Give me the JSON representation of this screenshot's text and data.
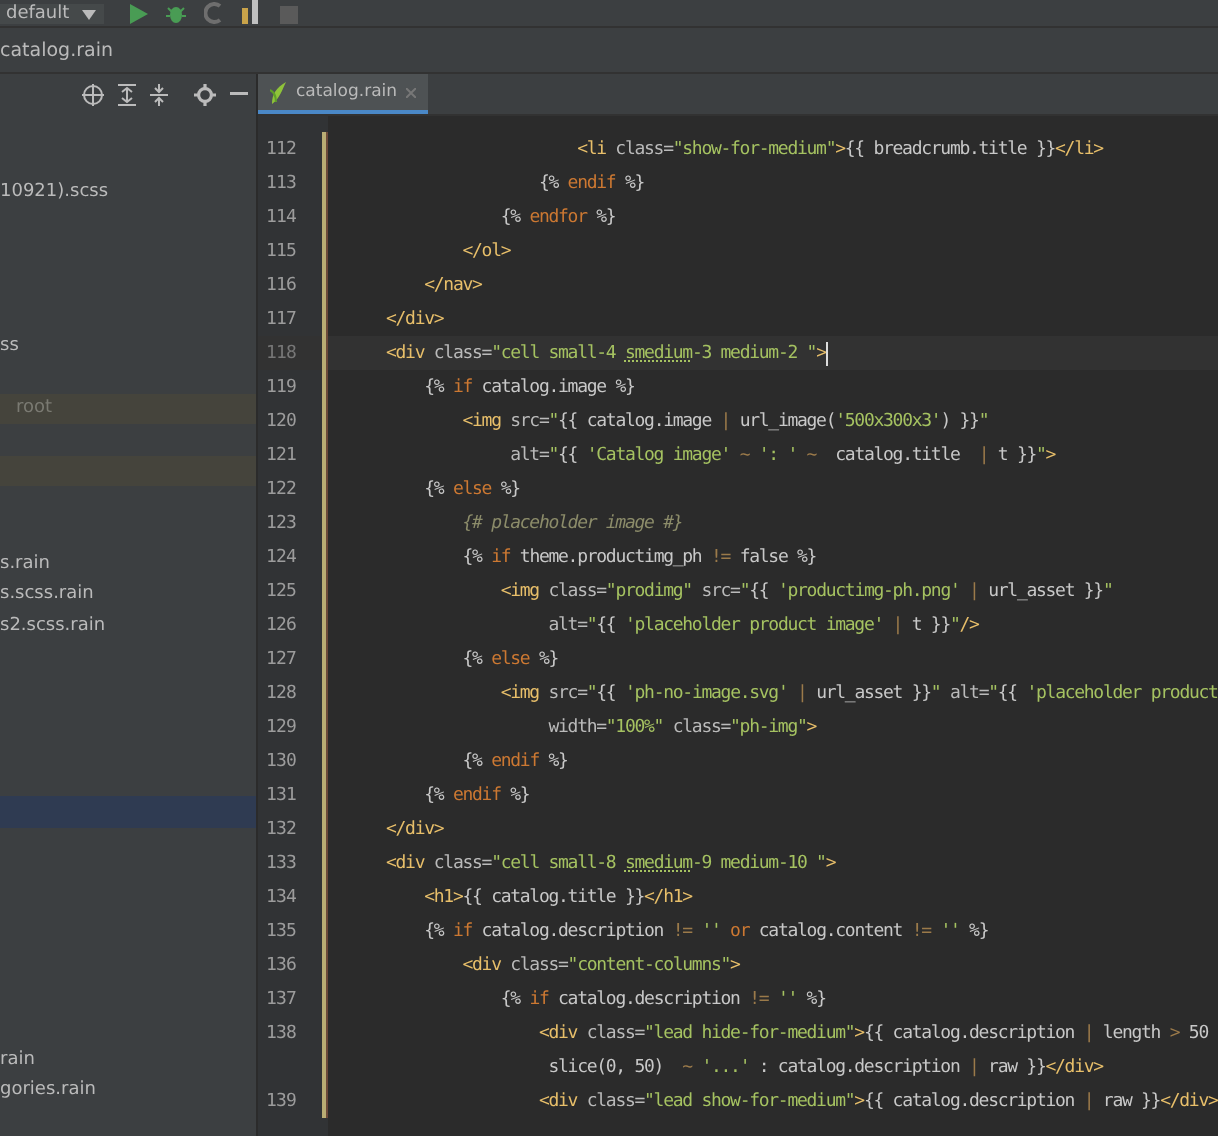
{
  "toolbar": {
    "run_configuration": "default"
  },
  "breadcrumb": [
    "catalog.rain"
  ],
  "project_tree": {
    "rows": [
      {
        "label": "10921).scss",
        "selected": false,
        "highlighted": false
      },
      {
        "label": "ss",
        "selected": false,
        "highlighted": false
      },
      {
        "label": "root",
        "selected": false,
        "highlighted": true
      },
      {
        "kind": "scope-band"
      },
      {
        "label": "s.rain",
        "selected": false,
        "highlighted": false
      },
      {
        "label": "s.scss.rain",
        "selected": false,
        "highlighted": false
      },
      {
        "label": "s2.scss.rain",
        "selected": false,
        "highlighted": false
      },
      {
        "selected": true,
        "highlighted": false
      },
      {
        "label": "rain",
        "selected": false,
        "highlighted": false
      },
      {
        "label": "gories.rain",
        "selected": false,
        "highlighted": false
      }
    ]
  },
  "editor": {
    "tabs": [
      {
        "label": "catalog.rain",
        "selected": true
      }
    ],
    "lines": [
      {
        "number": "112",
        "current": false,
        "tokens": [
          {
            "kind": "tag",
            "text": "                    <li"
          },
          {
            "kind": "attr",
            "text": " class="
          },
          {
            "kind": "str",
            "text": "\"show-for-medium\""
          },
          {
            "kind": "tag",
            "text": ">"
          },
          {
            "kind": "plain",
            "text": "{{ breadcrumb.title }}"
          },
          {
            "kind": "tag",
            "text": "</li>"
          }
        ]
      },
      {
        "number": "113",
        "current": false,
        "tokens": [
          {
            "kind": "plain",
            "text": "                {% "
          },
          {
            "kind": "kw",
            "text": "endif"
          },
          {
            "kind": "plain",
            "text": " %}"
          }
        ]
      },
      {
        "number": "114",
        "current": false,
        "tokens": [
          {
            "kind": "plain",
            "text": "            {% "
          },
          {
            "kind": "kw",
            "text": "endfor"
          },
          {
            "kind": "plain",
            "text": " %}"
          }
        ]
      },
      {
        "number": "115",
        "current": false,
        "tokens": [
          {
            "kind": "tag",
            "text": "        </ol>"
          }
        ]
      },
      {
        "number": "116",
        "current": false,
        "tokens": [
          {
            "kind": "tag",
            "text": "    </nav>"
          }
        ]
      },
      {
        "number": "117",
        "current": false,
        "tokens": [
          {
            "kind": "tag",
            "text": "</div>"
          }
        ]
      },
      {
        "number": "118",
        "current": true,
        "tokens": [
          {
            "kind": "tag",
            "text": "<div"
          },
          {
            "kind": "attr",
            "text": " class="
          },
          {
            "kind": "str",
            "text": "\"cell small-4 "
          },
          {
            "kind": "typo",
            "text": "smedium"
          },
          {
            "kind": "str",
            "text": "-3 medium-2 \""
          },
          {
            "kind": "tag",
            "text": ">"
          }
        ]
      },
      {
        "number": "119",
        "current": false,
        "tokens": [
          {
            "kind": "plain",
            "text": "    {% "
          },
          {
            "kind": "kw",
            "text": "if"
          },
          {
            "kind": "plain",
            "text": " catalog.image %}"
          }
        ]
      },
      {
        "number": "120",
        "current": false,
        "tokens": [
          {
            "kind": "tag",
            "text": "        <img"
          },
          {
            "kind": "attr",
            "text": " src="
          },
          {
            "kind": "str",
            "text": "\""
          },
          {
            "kind": "plain",
            "text": "{{ catalog.image "
          },
          {
            "kind": "op",
            "text": "|"
          },
          {
            "kind": "plain",
            "text": " url_image("
          },
          {
            "kind": "str",
            "text": "'500x300x3'"
          },
          {
            "kind": "plain",
            "text": ") }}"
          },
          {
            "kind": "str",
            "text": "\""
          }
        ]
      },
      {
        "number": "121",
        "current": false,
        "tokens": [
          {
            "kind": "attr",
            "text": "             alt="
          },
          {
            "kind": "str",
            "text": "\""
          },
          {
            "kind": "plain",
            "text": "{{ "
          },
          {
            "kind": "str",
            "text": "'Catalog image'"
          },
          {
            "kind": "op",
            "text": " ~ "
          },
          {
            "kind": "str",
            "text": "': '"
          },
          {
            "kind": "op",
            "text": " ~ "
          },
          {
            "kind": "plain",
            "text": " catalog.title  "
          },
          {
            "kind": "op",
            "text": "|"
          },
          {
            "kind": "plain",
            "text": " t }}"
          },
          {
            "kind": "str",
            "text": "\""
          },
          {
            "kind": "tag",
            "text": ">"
          }
        ]
      },
      {
        "number": "122",
        "current": false,
        "tokens": [
          {
            "kind": "plain",
            "text": "    {% "
          },
          {
            "kind": "kw",
            "text": "else"
          },
          {
            "kind": "plain",
            "text": " %}"
          }
        ]
      },
      {
        "number": "123",
        "current": false,
        "tokens": [
          {
            "kind": "comment",
            "text": "        {# placeholder image #}"
          }
        ]
      },
      {
        "number": "124",
        "current": false,
        "tokens": [
          {
            "kind": "plain",
            "text": "        {% "
          },
          {
            "kind": "kw",
            "text": "if"
          },
          {
            "kind": "plain",
            "text": " theme.productimg_ph "
          },
          {
            "kind": "op",
            "text": "!="
          },
          {
            "kind": "plain",
            "text": " false %}"
          }
        ]
      },
      {
        "number": "125",
        "current": false,
        "tokens": [
          {
            "kind": "tag",
            "text": "            <img"
          },
          {
            "kind": "attr",
            "text": " class="
          },
          {
            "kind": "str",
            "text": "\"prodimg\""
          },
          {
            "kind": "attr",
            "text": " src="
          },
          {
            "kind": "str",
            "text": "\""
          },
          {
            "kind": "plain",
            "text": "{{ "
          },
          {
            "kind": "str",
            "text": "'productimg-ph.png'"
          },
          {
            "kind": "op",
            "text": " | "
          },
          {
            "kind": "plain",
            "text": "url_asset }}"
          },
          {
            "kind": "str",
            "text": "\""
          }
        ]
      },
      {
        "number": "126",
        "current": false,
        "tokens": [
          {
            "kind": "attr",
            "text": "                 alt="
          },
          {
            "kind": "str",
            "text": "\""
          },
          {
            "kind": "plain",
            "text": "{{ "
          },
          {
            "kind": "str",
            "text": "'placeholder product image'"
          },
          {
            "kind": "op",
            "text": " | "
          },
          {
            "kind": "plain",
            "text": "t }}"
          },
          {
            "kind": "str",
            "text": "\""
          },
          {
            "kind": "tag",
            "text": "/>"
          }
        ]
      },
      {
        "number": "127",
        "current": false,
        "tokens": [
          {
            "kind": "plain",
            "text": "        {% "
          },
          {
            "kind": "kw",
            "text": "else"
          },
          {
            "kind": "plain",
            "text": " %}"
          }
        ]
      },
      {
        "number": "128",
        "current": false,
        "tokens": [
          {
            "kind": "tag",
            "text": "            <img"
          },
          {
            "kind": "attr",
            "text": " src="
          },
          {
            "kind": "str",
            "text": "\""
          },
          {
            "kind": "plain",
            "text": "{{ "
          },
          {
            "kind": "str",
            "text": "'ph-no-image.svg'"
          },
          {
            "kind": "op",
            "text": " | "
          },
          {
            "kind": "plain",
            "text": "url_asset }}"
          },
          {
            "kind": "str",
            "text": "\""
          },
          {
            "kind": "attr",
            "text": " alt="
          },
          {
            "kind": "str",
            "text": "\""
          },
          {
            "kind": "plain",
            "text": "{{ "
          },
          {
            "kind": "str",
            "text": "'placeholder product"
          }
        ]
      },
      {
        "number": "129",
        "current": false,
        "tokens": [
          {
            "kind": "attr",
            "text": "                 width="
          },
          {
            "kind": "str",
            "text": "\"100%\""
          },
          {
            "kind": "attr",
            "text": " class="
          },
          {
            "kind": "str",
            "text": "\"ph-img\""
          },
          {
            "kind": "tag",
            "text": ">"
          }
        ]
      },
      {
        "number": "130",
        "current": false,
        "tokens": [
          {
            "kind": "plain",
            "text": "        {% "
          },
          {
            "kind": "kw",
            "text": "endif"
          },
          {
            "kind": "plain",
            "text": " %}"
          }
        ]
      },
      {
        "number": "131",
        "current": false,
        "tokens": [
          {
            "kind": "plain",
            "text": "    {% "
          },
          {
            "kind": "kw",
            "text": "endif"
          },
          {
            "kind": "plain",
            "text": " %}"
          }
        ]
      },
      {
        "number": "132",
        "current": false,
        "tokens": [
          {
            "kind": "tag",
            "text": "</div>"
          }
        ]
      },
      {
        "number": "133",
        "current": false,
        "tokens": [
          {
            "kind": "tag",
            "text": "<div"
          },
          {
            "kind": "attr",
            "text": " class="
          },
          {
            "kind": "str",
            "text": "\"cell small-8 "
          },
          {
            "kind": "typo",
            "text": "smedium"
          },
          {
            "kind": "str",
            "text": "-9 medium-10 \""
          },
          {
            "kind": "tag",
            "text": ">"
          }
        ]
      },
      {
        "number": "134",
        "current": false,
        "tokens": [
          {
            "kind": "tag",
            "text": "    <h1>"
          },
          {
            "kind": "plain",
            "text": "{{ catalog.title }}"
          },
          {
            "kind": "tag",
            "text": "</h1>"
          }
        ]
      },
      {
        "number": "135",
        "current": false,
        "tokens": [
          {
            "kind": "plain",
            "text": "    {% "
          },
          {
            "kind": "kw",
            "text": "if"
          },
          {
            "kind": "plain",
            "text": " catalog.description "
          },
          {
            "kind": "op",
            "text": "!="
          },
          {
            "kind": "str",
            "text": " ''"
          },
          {
            "kind": "kw",
            "text": " or"
          },
          {
            "kind": "plain",
            "text": " catalog.content "
          },
          {
            "kind": "op",
            "text": "!="
          },
          {
            "kind": "str",
            "text": " ''"
          },
          {
            "kind": "plain",
            "text": " %}"
          }
        ]
      },
      {
        "number": "136",
        "current": false,
        "tokens": [
          {
            "kind": "tag",
            "text": "        <div"
          },
          {
            "kind": "attr",
            "text": " class="
          },
          {
            "kind": "str",
            "text": "\"content-columns\""
          },
          {
            "kind": "tag",
            "text": ">"
          }
        ]
      },
      {
        "number": "137",
        "current": false,
        "tokens": [
          {
            "kind": "plain",
            "text": "            {% "
          },
          {
            "kind": "kw",
            "text": "if"
          },
          {
            "kind": "plain",
            "text": " catalog.description "
          },
          {
            "kind": "op",
            "text": "!="
          },
          {
            "kind": "str",
            "text": " ''"
          },
          {
            "kind": "plain",
            "text": " %}"
          }
        ]
      },
      {
        "number": "138",
        "current": false,
        "tokens": [
          {
            "kind": "tag",
            "text": "                <div"
          },
          {
            "kind": "attr",
            "text": " class="
          },
          {
            "kind": "str",
            "text": "\"lead hide-for-medium\""
          },
          {
            "kind": "tag",
            "text": ">"
          },
          {
            "kind": "plain",
            "text": "{{ catalog.description "
          },
          {
            "kind": "op",
            "text": "|"
          },
          {
            "kind": "plain",
            "text": " length "
          },
          {
            "kind": "op",
            "text": ">"
          },
          {
            "kind": "plain",
            "text": " 50"
          }
        ],
        "continuation": [
          {
            "kind": "plain",
            "text": "                 slice(0, 50)  "
          },
          {
            "kind": "op",
            "text": "~"
          },
          {
            "kind": "str",
            "text": " '...'"
          },
          {
            "kind": "plain",
            "text": " : catalog.description "
          },
          {
            "kind": "op",
            "text": "|"
          },
          {
            "kind": "plain",
            "text": " raw }}"
          },
          {
            "kind": "tag",
            "text": "</div>"
          }
        ]
      },
      {
        "number": "139",
        "current": false,
        "tokens": [
          {
            "kind": "tag",
            "text": "                <div"
          },
          {
            "kind": "attr",
            "text": " class="
          },
          {
            "kind": "str",
            "text": "\"lead show-for-medium\""
          },
          {
            "kind": "tag",
            "text": ">"
          },
          {
            "kind": "plain",
            "text": "{{ catalog.description "
          },
          {
            "kind": "op",
            "text": "|"
          },
          {
            "kind": "plain",
            "text": " raw }}"
          },
          {
            "kind": "tag",
            "text": "</div>"
          }
        ]
      }
    ]
  }
}
